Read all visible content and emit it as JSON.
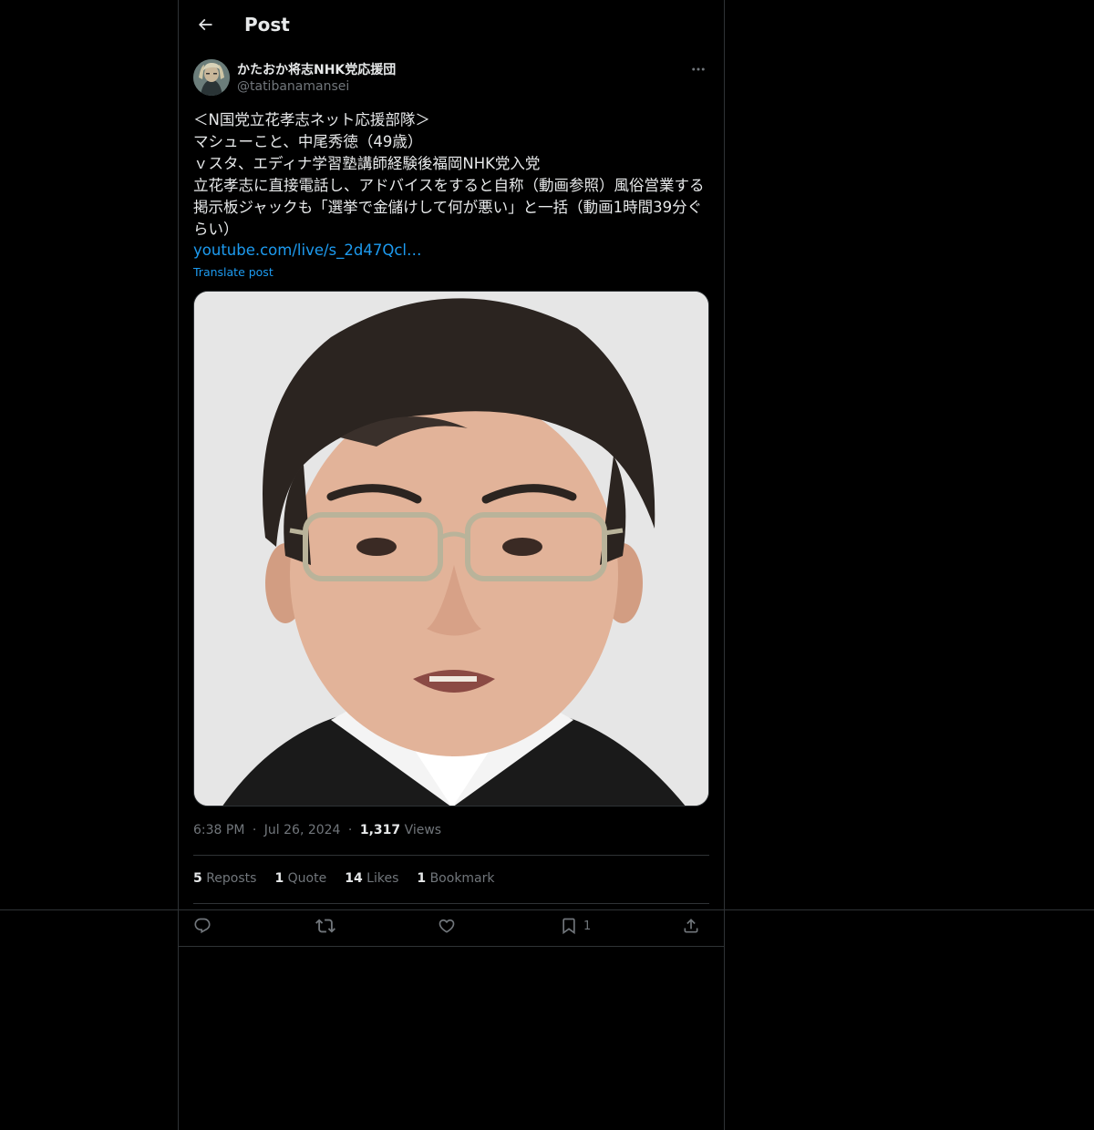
{
  "header": {
    "title": "Post"
  },
  "author": {
    "display_name": "かたおか将志NHK党応援団",
    "handle": "@tatibanamansei"
  },
  "post": {
    "text": "＜N国党立花孝志ネット応援部隊＞\nマシューこと、中尾秀徳（49歳）\nｖスタ、エディナ学習塾講師経験後福岡NHK党入党\n立花孝志に直接電話し、アドバイスをすると自称（動画参照）風俗営業する掲示板ジャックも「選挙で金儲けして何が悪い」と一括（動画1時間39分ぐらい）",
    "link": "youtube.com/live/s_2d47Qcl…",
    "translate_label": "Translate post"
  },
  "meta": {
    "time": "6:38 PM",
    "dot1": "·",
    "date": "Jul 26, 2024",
    "dot2": "·",
    "views_count": "1,317",
    "views_label": "Views"
  },
  "stats": {
    "reposts_count": "5",
    "reposts_label": "Reposts",
    "quotes_count": "1",
    "quotes_label": "Quote",
    "likes_count": "14",
    "likes_label": "Likes",
    "bookmarks_count": "1",
    "bookmarks_label": "Bookmark"
  },
  "actions": {
    "bookmark_count": "1"
  },
  "colors": {
    "background": "#000000",
    "text": "#e7e9ea",
    "secondary": "#71767b",
    "link": "#1d9bf0",
    "border": "#2f3336"
  },
  "icons": [
    "back-arrow-icon",
    "more-icon",
    "reply-icon",
    "repost-icon",
    "like-icon",
    "bookmark-icon",
    "share-icon"
  ]
}
